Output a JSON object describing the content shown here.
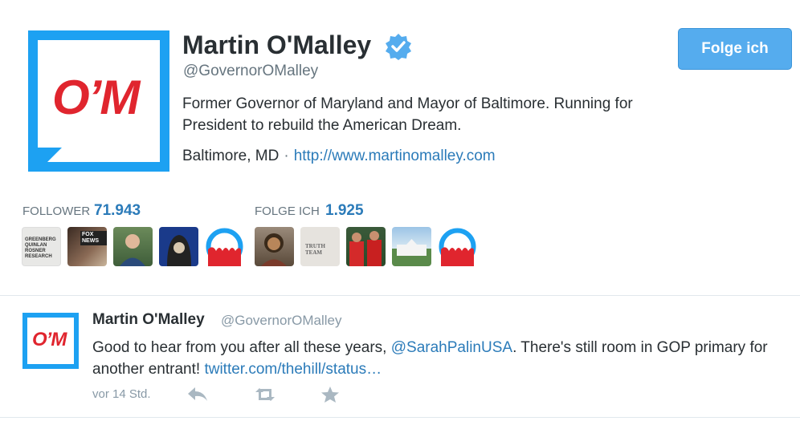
{
  "profile": {
    "name": "Martin O'Malley",
    "handle": "@GovernorOMalley",
    "avatar_text": "O’M",
    "bio": "Former Governor of Maryland and Mayor of Baltimore. Running for President to rebuild the American Dream.",
    "location": "Baltimore, MD",
    "separator": "·",
    "url": "http://www.martinomalley.com",
    "follow_button": "Folge ich"
  },
  "stats": {
    "followers_label": "FOLLOWER",
    "followers_value": "71.943",
    "following_label": "FOLGE ICH",
    "following_value": "1.925"
  },
  "follower_thumbs": [
    {
      "name": "greenberg-quinlan-rosner",
      "text": "GREENBERG QUINLAN ROSNER RESEARCH"
    },
    {
      "name": "fox-news",
      "text": "FOX NEWS"
    },
    {
      "name": "man-portrait",
      "text": ""
    },
    {
      "name": "hooded-figure",
      "text": ""
    },
    {
      "name": "omalley-logo",
      "text": ""
    }
  ],
  "following_thumbs": [
    {
      "name": "woman-portrait",
      "text": ""
    },
    {
      "name": "truth-team",
      "text": "TRUTH TEAM"
    },
    {
      "name": "soccer-team",
      "text": ""
    },
    {
      "name": "white-house",
      "text": ""
    },
    {
      "name": "omalley-logo",
      "text": ""
    }
  ],
  "tweet": {
    "name": "Martin O'Malley",
    "handle": "@GovernorOMalley",
    "avatar_text": "O’M",
    "text_before": "Good to hear from you after all these years, ",
    "mention": "@SarahPalinUSA",
    "text_after": ". There's still room in GOP primary for another entrant! ",
    "link": "twitter.com/thehill/status…",
    "time": "vor 14 Std."
  },
  "icons": {
    "verified": "verified-badge-icon",
    "reply": "reply-icon",
    "retweet": "retweet-icon",
    "favorite": "star-icon"
  },
  "colors": {
    "accent": "#1da1f2",
    "link": "#2b7bb9",
    "brand_red": "#e0252e",
    "follow_button": "#55acee"
  }
}
